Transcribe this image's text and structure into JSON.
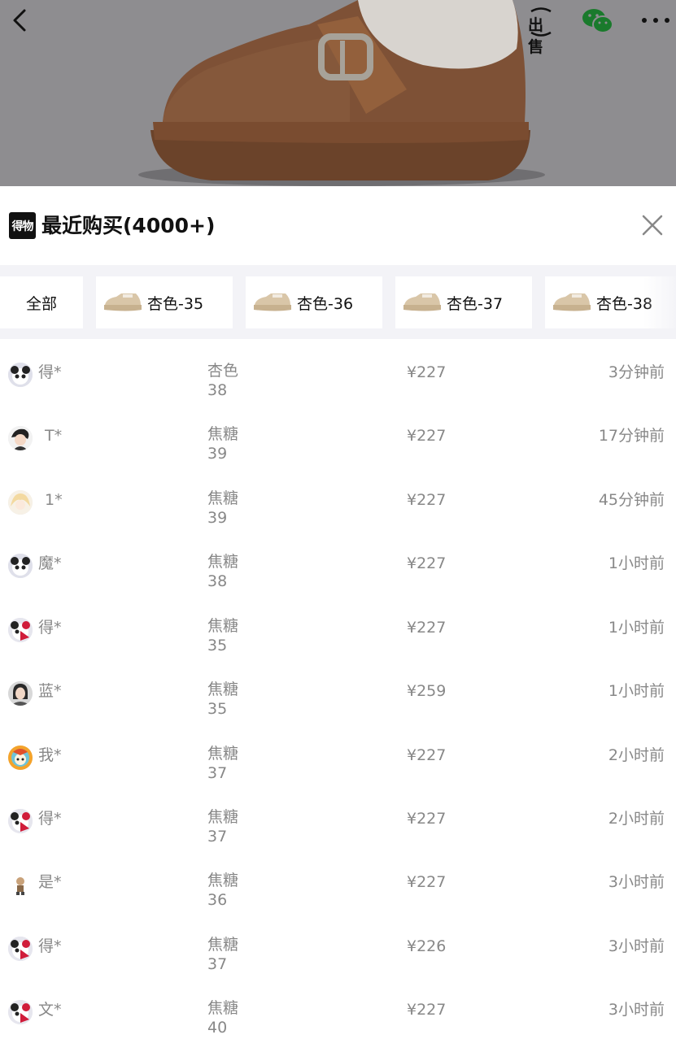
{
  "nav": {
    "sell_label": "出售"
  },
  "sheet": {
    "brand_logo_text": "得物",
    "title": "最近购买(4000+)"
  },
  "filters": [
    {
      "label": "全部",
      "thumb": false
    },
    {
      "label": "杏色-35",
      "thumb": true
    },
    {
      "label": "杏色-36",
      "thumb": true
    },
    {
      "label": "杏色-37",
      "thumb": true
    },
    {
      "label": "杏色-38",
      "thumb": true
    }
  ],
  "purchases": [
    {
      "user": "得*",
      "color": "杏色",
      "size": "38",
      "price": "¥227",
      "time": "3分钟前",
      "avatar": "panda"
    },
    {
      "user": "T*",
      "color": "焦糖",
      "size": "39",
      "price": "¥227",
      "time": "17分钟前",
      "avatar": "boy"
    },
    {
      "user": "1*",
      "color": "焦糖",
      "size": "39",
      "price": "¥227",
      "time": "45分钟前",
      "avatar": "anime"
    },
    {
      "user": "魔*",
      "color": "焦糖",
      "size": "38",
      "price": "¥227",
      "time": "1小时前",
      "avatar": "panda"
    },
    {
      "user": "得*",
      "color": "焦糖",
      "size": "35",
      "price": "¥227",
      "time": "1小时前",
      "avatar": "red"
    },
    {
      "user": "蓝*",
      "color": "焦糖",
      "size": "35",
      "price": "¥259",
      "time": "1小时前",
      "avatar": "photo"
    },
    {
      "user": "我*",
      "color": "焦糖",
      "size": "37",
      "price": "¥227",
      "time": "2小时前",
      "avatar": "colorful"
    },
    {
      "user": "得*",
      "color": "焦糖",
      "size": "37",
      "price": "¥227",
      "time": "2小时前",
      "avatar": "red"
    },
    {
      "user": "是*",
      "color": "焦糖",
      "size": "36",
      "price": "¥227",
      "time": "3小时前",
      "avatar": "small"
    },
    {
      "user": "得*",
      "color": "焦糖",
      "size": "37",
      "price": "¥226",
      "time": "3小时前",
      "avatar": "red"
    },
    {
      "user": "文*",
      "color": "焦糖",
      "size": "40",
      "price": "¥227",
      "time": "3小时前",
      "avatar": "red"
    }
  ]
}
